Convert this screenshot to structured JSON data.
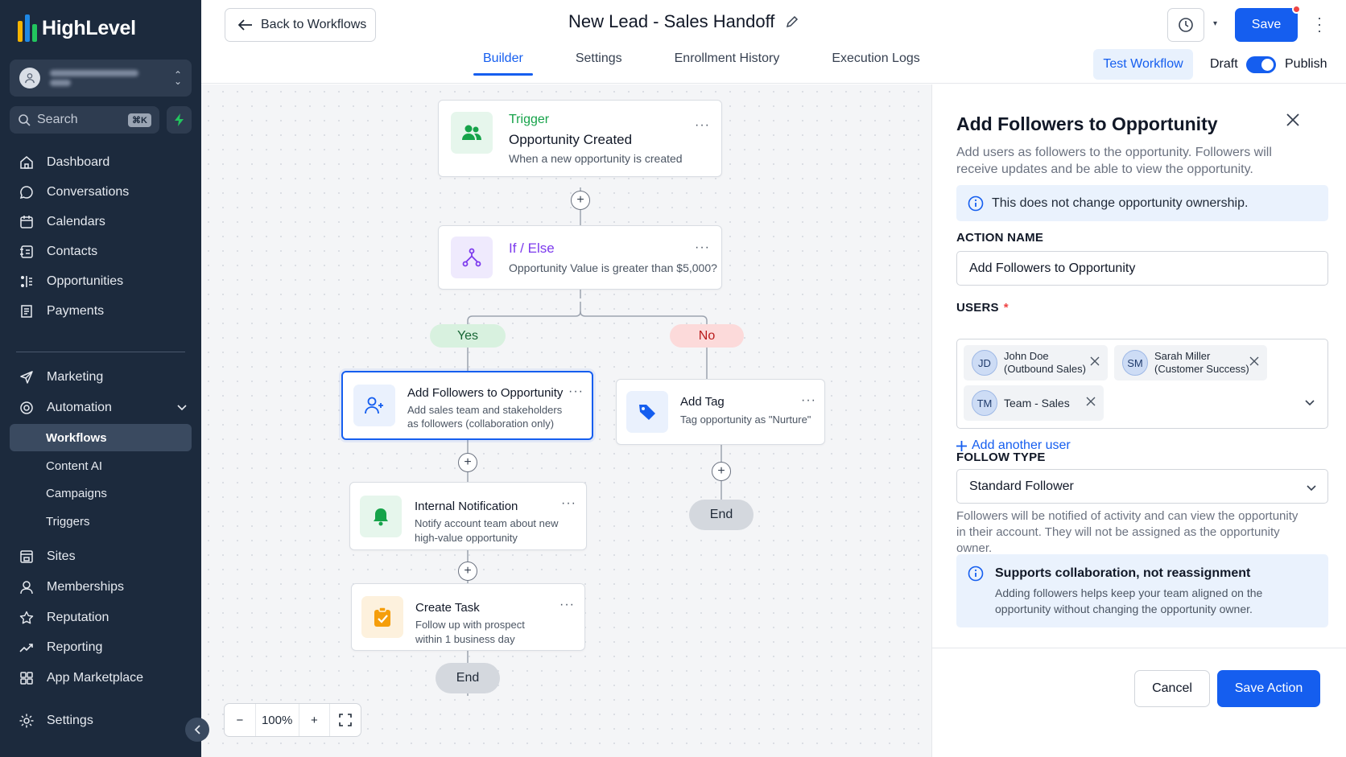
{
  "brand": {
    "name": "HighLevel",
    "accent": "#155eef",
    "sidebar_bg": "#1c2a3d"
  },
  "sidebar": {
    "search_placeholder": "Search",
    "search_shortcut": "⌘K",
    "items": [
      {
        "label": "Dashboard",
        "icon": "home-icon"
      },
      {
        "label": "Conversations",
        "icon": "chat-icon"
      },
      {
        "label": "Calendars",
        "icon": "calendar-icon"
      },
      {
        "label": "Contacts",
        "icon": "contacts-icon"
      },
      {
        "label": "Opportunities",
        "icon": "opportunities-icon"
      },
      {
        "label": "Payments",
        "icon": "receipt-icon"
      },
      {
        "label": "Marketing",
        "icon": "send-icon"
      },
      {
        "label": "Automation",
        "icon": "automation-icon"
      },
      {
        "label": "Sites",
        "icon": "sites-icon"
      },
      {
        "label": "Memberships",
        "icon": "user-icon"
      },
      {
        "label": "Reputation",
        "icon": "star-icon"
      },
      {
        "label": "Reporting",
        "icon": "trend-icon"
      },
      {
        "label": "App Marketplace",
        "icon": "grid-icon"
      },
      {
        "label": "Settings",
        "icon": "gear-icon"
      }
    ],
    "automation_sub": [
      "Workflows",
      "Content AI",
      "Campaigns",
      "Triggers"
    ],
    "active_sub": "Workflows"
  },
  "topbar": {
    "back_label": "Back to Workflows",
    "title": "New Lead - Sales Handoff",
    "tabs": [
      "Builder",
      "Settings",
      "Enrollment History",
      "Execution Logs"
    ],
    "active_tab": "Builder",
    "save_label": "Save",
    "test_label": "Test Workflow",
    "draft_label": "Draft",
    "publish_label": "Publish",
    "published": true
  },
  "canvas": {
    "trigger": {
      "kind": "Trigger",
      "title": "Opportunity Created",
      "subtitle": "When a new opportunity is created"
    },
    "ifelse": {
      "title": "If / Else",
      "subtitle": "Opportunity Value is greater than $5,000?"
    },
    "yes_label": "Yes",
    "no_label": "No",
    "yes_branch": [
      {
        "title": "Add Followers to Opportunity",
        "subtitle_1": "Add sales team and stakeholders",
        "subtitle_2": "as followers (collaboration only)"
      },
      {
        "title": "Internal Notification",
        "subtitle_1": "Notify account team about new",
        "subtitle_2": "high-value opportunity"
      },
      {
        "title": "Create Task",
        "subtitle_1": "Follow up with prospect",
        "subtitle_2": "within 1 business day"
      }
    ],
    "no_branch": [
      {
        "title": "Add Tag",
        "subtitle_1": "Tag opportunity as \"Nurture\""
      }
    ],
    "end_label": "End",
    "more_label": "···",
    "zoom": {
      "minus": "−",
      "value": "100%",
      "plus": "+"
    }
  },
  "panel": {
    "title": "Add Followers to Opportunity",
    "description": "Add users as followers to the opportunity. Followers will receive updates and be able to view the opportunity.",
    "notice": "This does not change opportunity ownership.",
    "action_name_label": "ACTION NAME",
    "action_name_value": "Add Followers to Opportunity",
    "users_label": "USERS",
    "required_mark": "*",
    "users": [
      {
        "initials": "JD",
        "name": "John Doe",
        "team": "(Outbound Sales)"
      },
      {
        "initials": "SM",
        "name": "Sarah Miller",
        "team": "(Customer Success)"
      },
      {
        "initials": "TM",
        "name": "Team - Sales",
        "team": ""
      }
    ],
    "add_user_label": "Add another user",
    "follow_type_label": "FOLLOW TYPE",
    "follow_type_value": "Standard Follower",
    "follow_help": "Followers will be notified of activity and can view the opportunity in their account. They will not be assigned as the opportunity owner.",
    "info_heading": "Supports collaboration, not reassignment",
    "info_body": "Adding followers helps keep your team aligned on the opportunity without changing the opportunity owner.",
    "cancel_label": "Cancel",
    "save_action_label": "Save Action"
  }
}
